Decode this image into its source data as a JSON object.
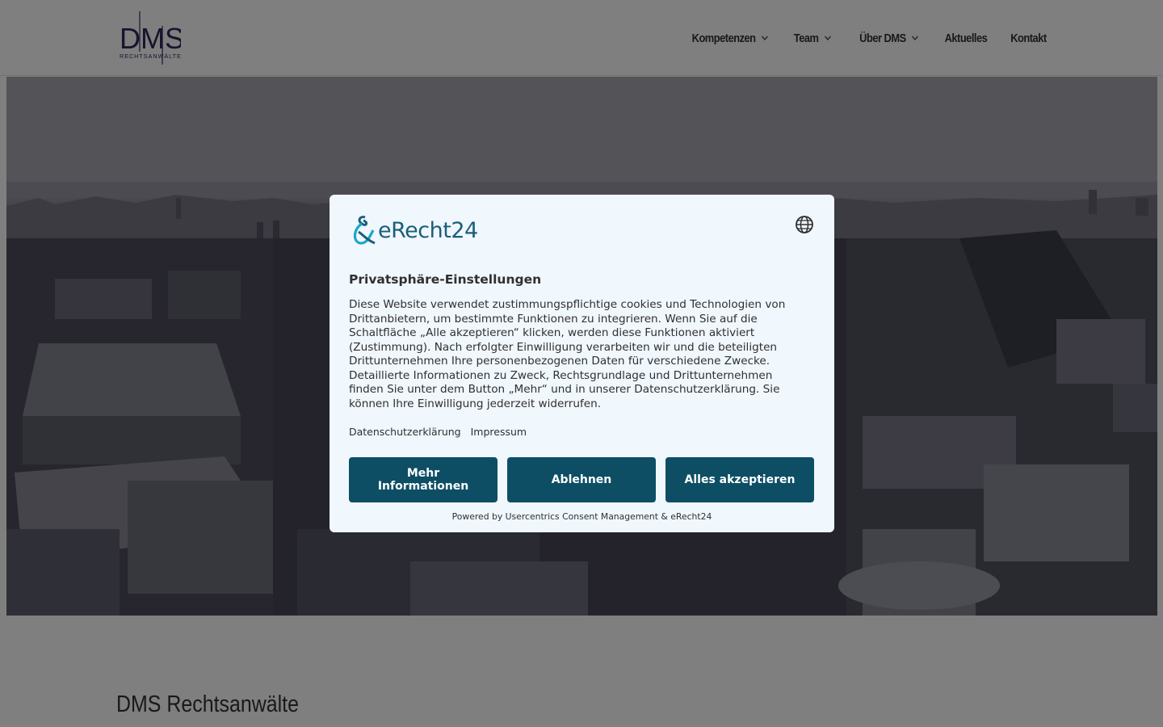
{
  "header": {
    "logo_text": "DMS",
    "logo_subtitle": "RECHTSANWÄLTE",
    "nav": [
      {
        "label": "Kompetenzen",
        "has_dropdown": true,
        "icon": "chevron-down-icon"
      },
      {
        "label": "Team",
        "has_dropdown": true,
        "icon": "chevron-down-icon"
      },
      {
        "label": "Über DMS",
        "has_dropdown": true,
        "icon": "chevron-down-icon"
      },
      {
        "label": "Aktuelles",
        "has_dropdown": false
      },
      {
        "label": "Kontakt",
        "has_dropdown": false
      }
    ]
  },
  "hero": {
    "image": "aerial-city-photo"
  },
  "main": {
    "title": "DMS Rechtsanwälte"
  },
  "consent": {
    "brand": "eRecht24",
    "brand_icon": "erecht24-logo-icon",
    "language_icon": "globe-icon",
    "title": "Privatsphäre-Einstellungen",
    "body_lines": [
      "Diese Website verwendet zustimmungspflichtige cookies und Technologien von",
      "Drittanbietern, um bestimmte Funktionen zu integrieren. Wenn Sie auf die",
      "Schaltfläche „Alle akzeptieren“ klicken, werden diese Funktionen aktiviert",
      "(Zustimmung). Nach erfolgter Einwilligung verarbeiten wir und die beteiligten",
      "Drittunternehmen Ihre personenbezogenen Daten für verschiedene Zwecke.",
      "Detaillierte Informationen zu Zweck, Rechtsgrundlage und Drittunternehmen",
      "finden Sie unter dem Button „Mehr“ und in unserer Datenschutzerklärung. Sie",
      "können Ihre Einwilligung jederzeit widerrufen."
    ],
    "links": {
      "privacy": "Datenschutzerklärung",
      "imprint": "Impressum"
    },
    "buttons": {
      "more": "Mehr Informationen",
      "decline": "Ablehnen",
      "accept_all": "Alles akzeptieren"
    },
    "powered_by": "Powered by Usercentrics Consent Management & eRecht24"
  },
  "colors": {
    "button": "#0d4e65",
    "modal_bg": "#f0f7fd",
    "brand": "#1a5f7a",
    "logo": "#2e2a5c"
  }
}
